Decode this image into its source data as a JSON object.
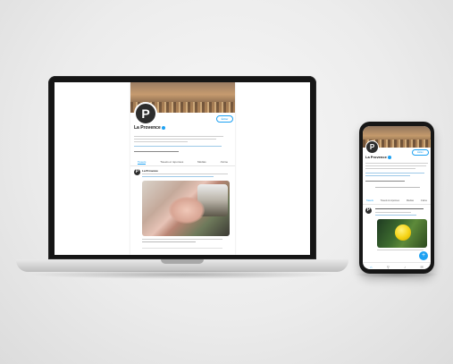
{
  "profile": {
    "name": "La Provence",
    "avatar_letter": "P",
    "edit_label": "Éditer"
  },
  "laptop": {
    "tabs": [
      "Tweets",
      "Tweets et réponses",
      "Médias",
      "J'aime"
    ],
    "tweet_author": "La Provence"
  },
  "phone": {
    "tabs": [
      "Tweets",
      "Tweets & réponses",
      "Médias",
      "J'aime"
    ],
    "nav_icons": [
      "home-icon",
      "search-icon",
      "bell-icon",
      "mail-icon"
    ],
    "fab_icon": "compose-icon"
  },
  "colors": {
    "accent": "#1da1f2",
    "bezel": "#151515"
  }
}
